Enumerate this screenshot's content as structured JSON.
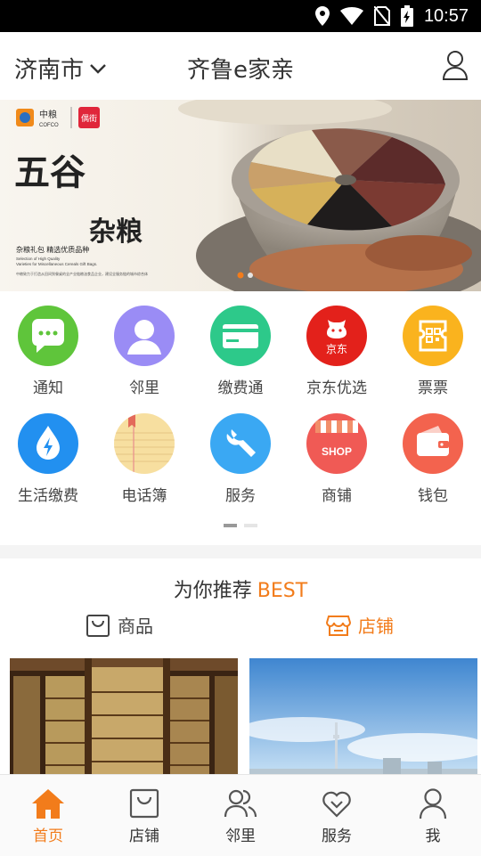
{
  "status_bar": {
    "time": "10:57",
    "icons": [
      "location-icon",
      "wifi-icon",
      "no-sim-icon",
      "battery-charging-icon"
    ]
  },
  "header": {
    "city": "济南市",
    "title": "齐鲁e家亲",
    "user_icon": "user-icon"
  },
  "banner": {
    "brand_1": "中粮",
    "brand_1_en": "COFCO",
    "brand_2": "偶街",
    "headline_1": "五谷",
    "headline_2": "杂粮",
    "tagline": "杂粮礼包 精选优质品种",
    "subline_en_1": "Selection of High Quality",
    "subline_en_2": "Varieties for Miscellaneous Cereals Gift Bags.",
    "fine_print": "中粮致力于打造从田间到餐桌的全产业链粮油食品企业，建设全服务链的城市综合体",
    "active_slide": 1,
    "slide_count": 2,
    "colors": {
      "accent": "#f27c1b"
    }
  },
  "grid": {
    "items": [
      {
        "label": "通知",
        "icon": "chat-bubble-icon",
        "color": "#5fc53b"
      },
      {
        "label": "邻里",
        "icon": "person-icon",
        "color": "#9a8cf5"
      },
      {
        "label": "缴费通",
        "icon": "card-icon",
        "color": "#2dc98a"
      },
      {
        "label": "京东优选",
        "icon": "jd-dog-icon",
        "color": "#e3211b"
      },
      {
        "label": "票票",
        "icon": "ticket-icon",
        "color": "#fab31e"
      },
      {
        "label": "生活缴费",
        "icon": "water-bolt-icon",
        "color": "#2290f0"
      },
      {
        "label": "电话簿",
        "icon": "notebook-icon",
        "color": "#f7dfa0"
      },
      {
        "label": "服务",
        "icon": "wrench-icon",
        "color": "#3aa8f3"
      },
      {
        "label": "商铺",
        "icon": "shop-icon",
        "color": "#f05a55"
      },
      {
        "label": "钱包",
        "icon": "wallet-icon",
        "color": "#f3634e"
      }
    ],
    "page_indicator": {
      "active": 1,
      "count": 2
    }
  },
  "recommend": {
    "title": "为你推荐",
    "title_accent": "BEST",
    "tabs": [
      {
        "label": "商品",
        "icon": "bag-icon",
        "active": false
      },
      {
        "label": "店铺",
        "icon": "store-icon",
        "active": true
      }
    ],
    "cards": [
      {
        "image": "library-bookshelf-photo"
      },
      {
        "image": "city-skyline-photo"
      }
    ]
  },
  "tabbar": {
    "items": [
      {
        "label": "首页",
        "icon": "home-icon",
        "active": true
      },
      {
        "label": "店铺",
        "icon": "bag-icon",
        "active": false
      },
      {
        "label": "邻里",
        "icon": "people-icon",
        "active": false
      },
      {
        "label": "服务",
        "icon": "heart-icon",
        "active": false
      },
      {
        "label": "我",
        "icon": "user-icon",
        "active": false
      }
    ]
  }
}
